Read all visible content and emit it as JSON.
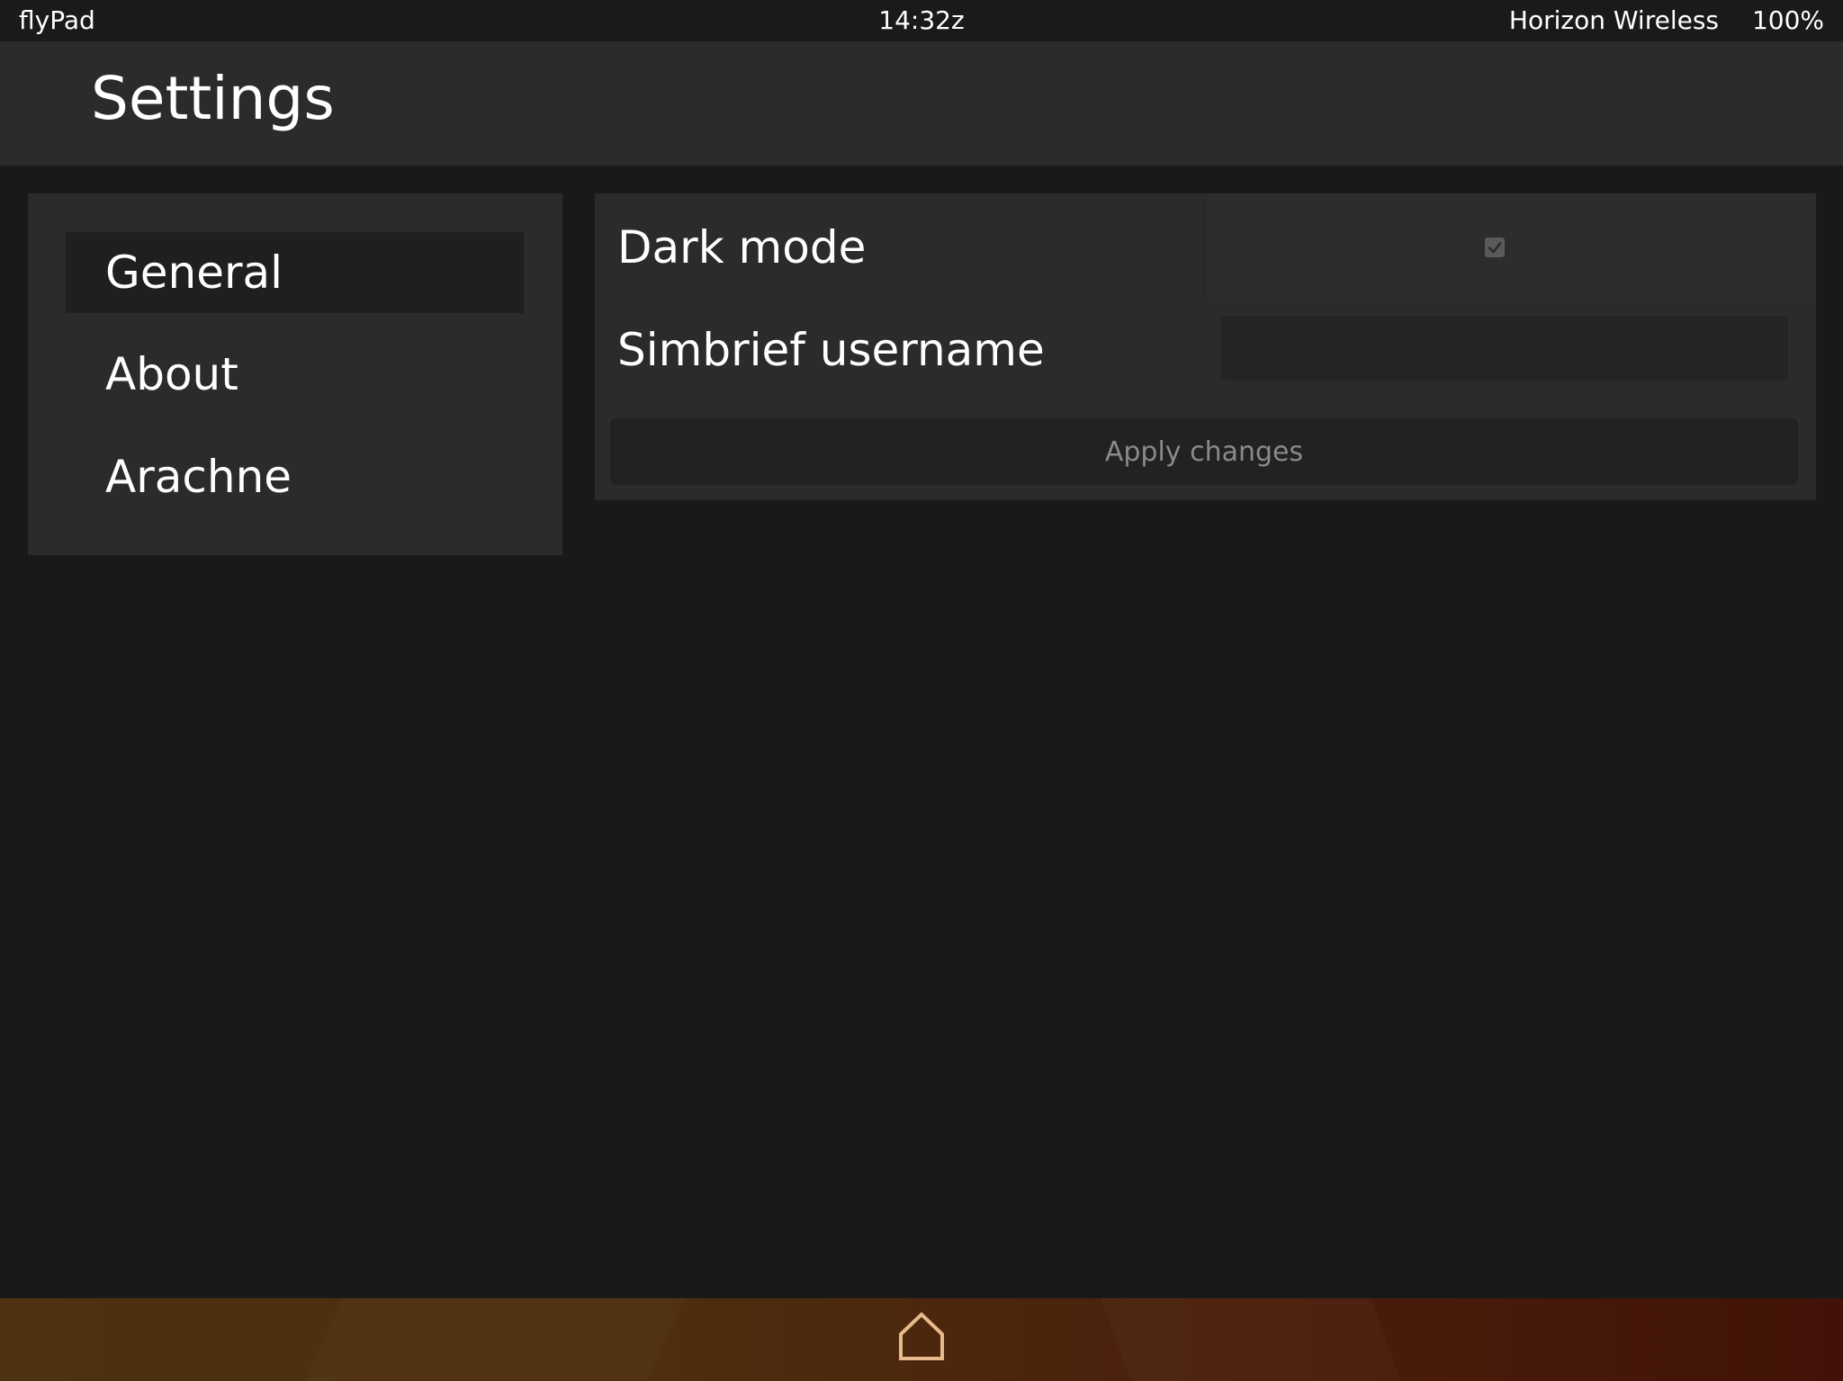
{
  "status_bar": {
    "app_name": "flyPad",
    "clock": "14:32z",
    "network": "Horizon Wireless",
    "battery": "100%"
  },
  "header": {
    "title": "Settings"
  },
  "sidebar": {
    "items": [
      {
        "label": "General",
        "active": true
      },
      {
        "label": "About",
        "active": false
      },
      {
        "label": "Arachne",
        "active": false
      }
    ]
  },
  "settings": {
    "dark_mode": {
      "label": "Dark mode",
      "checked": true
    },
    "simbrief": {
      "label": "Simbrief username",
      "value": "",
      "placeholder": ""
    },
    "apply_label": "Apply changes"
  },
  "bottom_bar": {
    "home_icon": "home-icon",
    "icon_color": "#e7b98c"
  },
  "colors": {
    "background": "#191919",
    "panel": "#2b2b2b",
    "active_item": "#1f1f1f",
    "bottom_gradient_start": "#4d3110",
    "bottom_gradient_end": "#421208"
  }
}
